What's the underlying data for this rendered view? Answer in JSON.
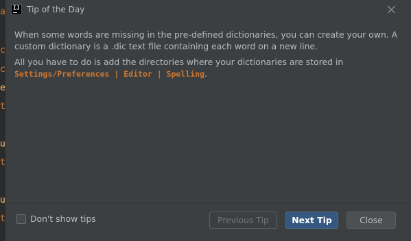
{
  "editor": {
    "chars": [
      "a",
      "c",
      "c",
      "e",
      "t",
      "u",
      "t",
      "u",
      "t"
    ]
  },
  "dialog": {
    "title": "Tip of the Day",
    "logo_text": "IJ",
    "paragraph1": "When some words are missing in the pre-defined dictionaries, you can create your own. A custom dictionary is a .dic text file containing each word on a new line.",
    "paragraph2_text": "All you have to do is add the directories where your dictionaries are stored in",
    "paragraph2_path": "Settings/Preferences | Editor | Spelling",
    "paragraph2_end": ".",
    "checkbox_label": "Don't show tips",
    "checkbox_checked": false,
    "buttons": {
      "previous": "Previous Tip",
      "next": "Next Tip",
      "close": "Close"
    }
  },
  "colors": {
    "dialog_bg": "#3c3f41",
    "accent_button": "#365880",
    "path_color": "#cc7832"
  }
}
